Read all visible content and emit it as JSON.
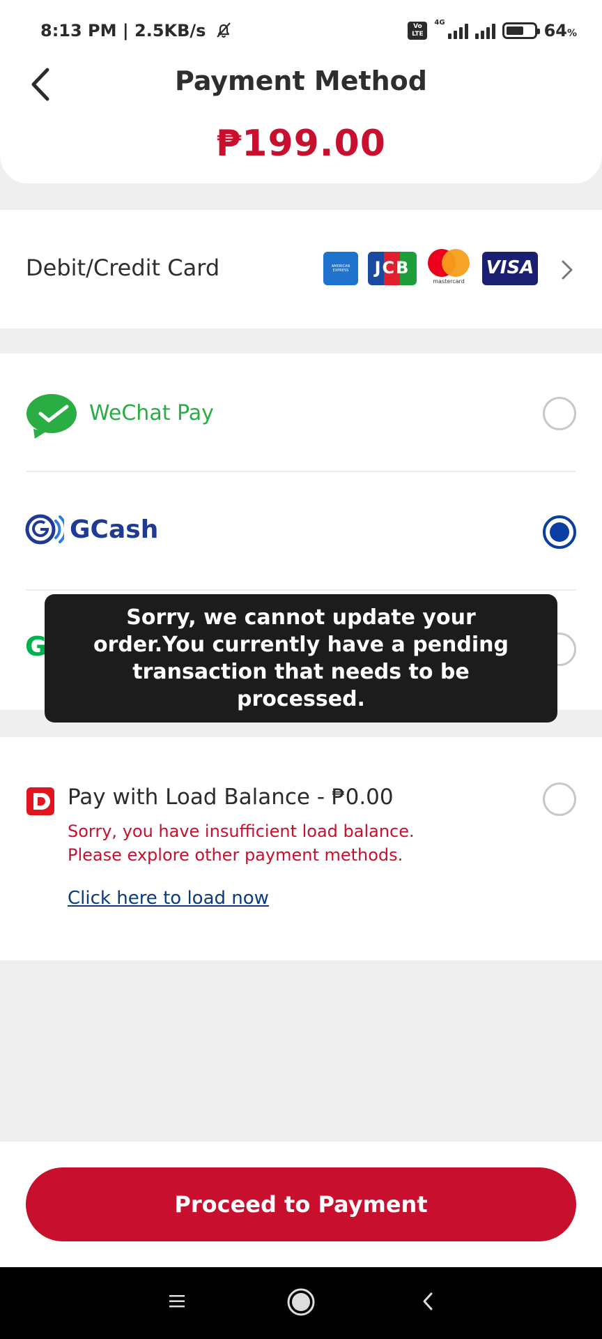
{
  "status_bar": {
    "time_speed": "8:13 PM | 2.5KB/s",
    "volte_label": "Vo LTE",
    "network_label": "4G",
    "battery_percent": "64",
    "battery_unit": "%",
    "icons": [
      "mute-bell-icon",
      "volte-icon",
      "signal-icon",
      "battery-icon"
    ]
  },
  "header": {
    "title": "Payment Method",
    "amount": "₱199.00",
    "back_icon": "chevron-left-icon"
  },
  "card_option": {
    "label": "Debit/Credit Card",
    "brands": {
      "amex": "AMERICAN EXPRESS",
      "jcb": "JCB",
      "mastercard": "mastercard",
      "visa": "VISA"
    }
  },
  "wallets": {
    "wechat": {
      "label": "WeChat Pay",
      "selected": false
    },
    "gcash": {
      "label": "GCash",
      "selected": true
    },
    "grab": {
      "label": "GrabPay",
      "selected": false
    }
  },
  "load_balance": {
    "title": "Pay with Load Balance - ₱0.00",
    "error_line1": "Sorry, you have insufficient load balance.",
    "error_line2": "Please explore other payment methods.",
    "link": "Click here to load now"
  },
  "toast": {
    "message": "Sorry, we cannot update your order.You currently have a pending transaction that needs to be processed."
  },
  "footer": {
    "proceed_label": "Proceed to Payment"
  },
  "colors": {
    "brand_red": "#c8102e",
    "gcash_blue": "#0a3ea3",
    "wechat_green": "#2aae43",
    "grab_green": "#00b14f"
  }
}
